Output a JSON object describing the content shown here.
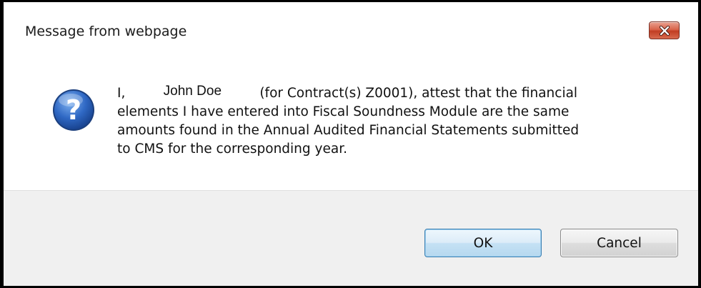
{
  "window": {
    "title": "Message from webpage",
    "close_icon": "close-icon"
  },
  "message": {
    "icon": "question-icon",
    "prefix": "I,",
    "name": "John Doe",
    "line1_rest": "(for Contract(s) Z0001), attest that the financial",
    "line2": "elements I have entered into Fiscal Soundness Module are the same",
    "line3": "amounts found in the Annual Audited Financial Statements submitted",
    "line4": "to CMS for the corresponding year."
  },
  "buttons": {
    "ok_label": "OK",
    "cancel_label": "Cancel"
  },
  "colors": {
    "close_button": "#c9442a",
    "icon_blue": "#2f68c4",
    "footer_bg": "#f0f0f0",
    "ok_border": "#3c7fb1"
  }
}
